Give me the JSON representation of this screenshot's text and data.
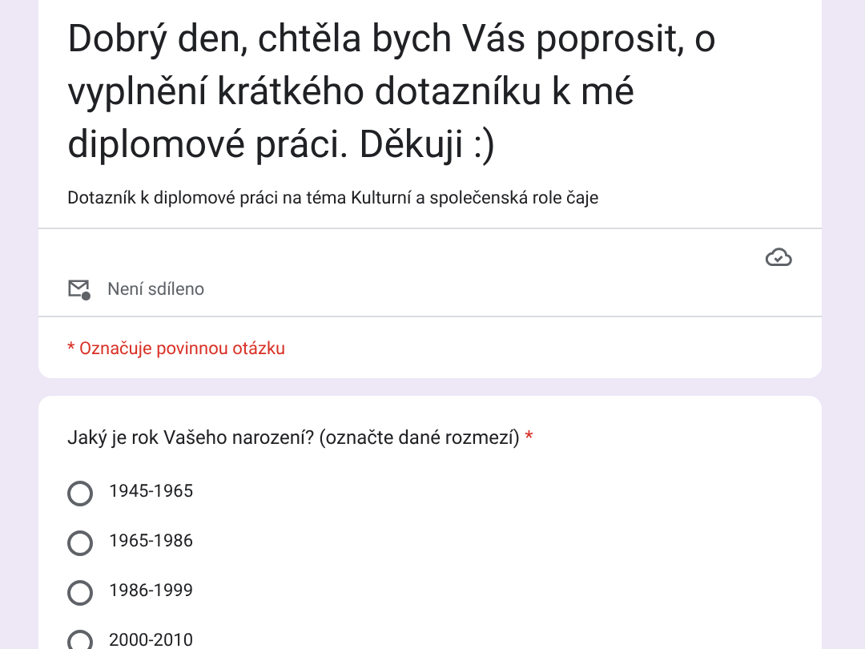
{
  "header": {
    "title": "Dobrý den, chtěla bych Vás poprosit, o vyplnění krátkého dotazníku k mé diplomové práci. Děkuji :)",
    "description": "Dotazník k diplomové práci na téma Kulturní a společenská role čaje",
    "sharing": "Není sdíleno",
    "required_note": "* Označuje povinnou otázku"
  },
  "question": {
    "text": "Jaký je rok Vašeho narození? (označte dané rozmezí)",
    "required_mark": "*",
    "options": [
      {
        "label": "1945-1965",
        "selected": false
      },
      {
        "label": "1965-1986",
        "selected": false
      },
      {
        "label": "1986-1999",
        "selected": false
      },
      {
        "label": "2000-2010",
        "selected": false
      }
    ]
  }
}
